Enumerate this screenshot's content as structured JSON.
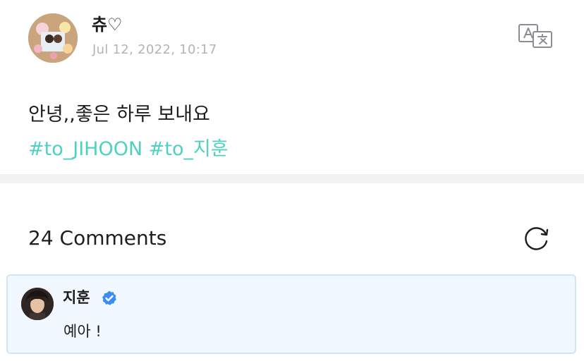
{
  "post": {
    "author": "츄♡",
    "date": "Jul 12, 2022, 10:17",
    "text": "안녕,,좋은 하루 보내요",
    "hashtags": [
      "#to_JIHOON",
      "#to_지훈"
    ]
  },
  "comments": {
    "title": "24 Comments",
    "items": [
      {
        "author": "지훈",
        "verified": true,
        "text": "예아 !"
      }
    ]
  },
  "icons": {
    "translate": "translate-icon",
    "refresh": "refresh-icon",
    "verified": "verified-badge-icon"
  },
  "colors": {
    "hashtag": "#4fd1c1",
    "comment_background": "#f1f8ff",
    "comment_border": "#cfe6f7",
    "verified": "#3b8ef0",
    "date": "#b3b3b8"
  }
}
